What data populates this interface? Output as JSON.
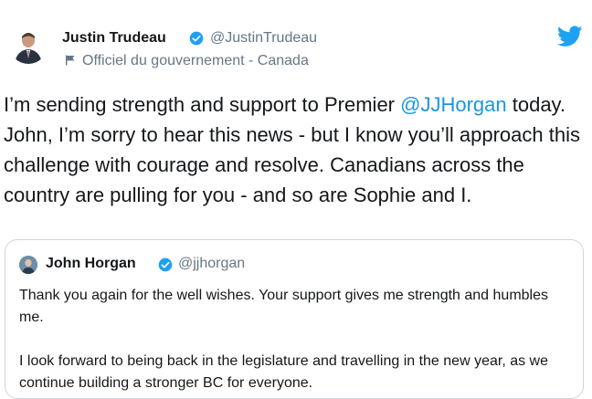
{
  "tweet": {
    "author_name": "Justin Trudeau",
    "handle": "@JustinTrudeau",
    "gov_label": "Officiel du gouvernement - Canada",
    "text_before": "I’m sending strength and support to Premier ",
    "mention": "@JJHorgan",
    "text_after": " today. John, I’m sorry to hear this news - but I know you’ll approach this challenge with courage and resolve. Canadians across the country are pulling for you - and so are Sophie and I."
  },
  "quoted": {
    "author_name": "John Horgan",
    "handle": "@jjhorgan",
    "paragraph_1": "Thank you again for the well wishes. Your support gives me strength and humbles me.",
    "paragraph_2": "I look forward to being back in the legislature and travelling in the new year, as we continue building a stronger BC for everyone."
  },
  "colors": {
    "verified": "#1da1f2",
    "twitter_brand": "#1da1f2",
    "mention": "#1b95e0",
    "secondary_text": "#657786",
    "border": "#ccd6dd"
  },
  "icons": {
    "verified": "verified-badge-icon",
    "government": "flag-icon",
    "brand": "twitter-bird-icon"
  }
}
